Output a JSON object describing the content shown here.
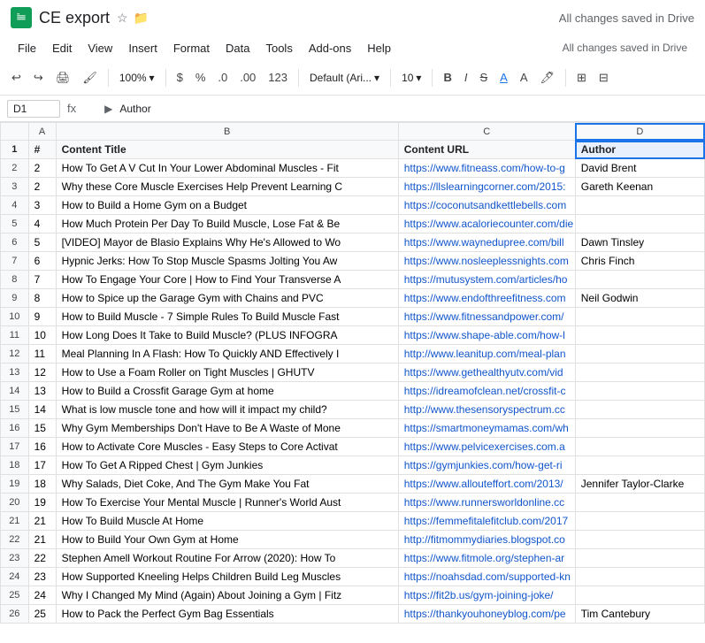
{
  "titleBar": {
    "appName": "CE export",
    "saveStatus": "All changes saved in Drive"
  },
  "menuBar": {
    "items": [
      "File",
      "Edit",
      "View",
      "Insert",
      "Format",
      "Data",
      "Tools",
      "Add-ons",
      "Help"
    ]
  },
  "toolbar": {
    "zoom": "100%",
    "currency": "$",
    "percent": "%",
    "decimal1": ".0",
    "decimal2": ".00",
    "number": "123",
    "font": "Default (Ari...",
    "fontSize": "10"
  },
  "formulaBar": {
    "cellRef": "D1",
    "value": "Author"
  },
  "sheet": {
    "columns": [
      "",
      "A",
      "B",
      "C",
      "D"
    ],
    "headers": [
      "#",
      "Content Title",
      "Content URL",
      "Author"
    ],
    "rows": [
      {
        "num": "1",
        "a": "2",
        "b": "How To Get A V Cut In Your Lower Abdominal Muscles - Fit",
        "c": "https://www.fitneass.com/how-to-g",
        "d": "David Brent"
      },
      {
        "num": "2",
        "a": "2",
        "b": "Why these Core Muscle Exercises Help Prevent Learning C",
        "c": "https://llslearningcorner.com/2015:",
        "d": "Gareth Keenan"
      },
      {
        "num": "3",
        "a": "3",
        "b": "How to Build a Home Gym on a Budget",
        "c": "https://coconutsandkettlebells.com",
        "d": ""
      },
      {
        "num": "4",
        "a": "4",
        "b": "How Much Protein Per Day To Build Muscle, Lose Fat & Be",
        "c": "https://www.acaloriecounter.com/die",
        "d": ""
      },
      {
        "num": "5",
        "a": "5",
        "b": "[VIDEO] Mayor de Blasio Explains Why He's Allowed to Wo",
        "c": "https://www.waynedupree.com/bill",
        "d": "Dawn Tinsley"
      },
      {
        "num": "6",
        "a": "6",
        "b": "Hypnic Jerks: How To Stop Muscle Spasms Jolting You Aw",
        "c": "https://www.nosleeplessnights.com",
        "d": "Chris Finch"
      },
      {
        "num": "7",
        "a": "7",
        "b": "How To Engage Your Core | How to Find Your Transverse A",
        "c": "https://mutusystem.com/articles/ho",
        "d": ""
      },
      {
        "num": "8",
        "a": "8",
        "b": "How to Spice up the Garage Gym with Chains and PVC",
        "c": "https://www.endofthreefitness.com",
        "d": "Neil Godwin"
      },
      {
        "num": "9",
        "a": "9",
        "b": "How to Build Muscle - 7 Simple Rules To Build Muscle Fast",
        "c": "https://www.fitnessandpower.com/",
        "d": ""
      },
      {
        "num": "10",
        "a": "10",
        "b": "How Long Does It Take to Build Muscle? (PLUS INFOGRA",
        "c": "https://www.shape-able.com/how-l",
        "d": ""
      },
      {
        "num": "11",
        "a": "11",
        "b": "Meal Planning In A Flash: How To Quickly AND Effectively I",
        "c": "http://www.leanitup.com/meal-plan",
        "d": ""
      },
      {
        "num": "12",
        "a": "12",
        "b": "How to Use a Foam Roller on Tight Muscles | GHUTV",
        "c": "https://www.gethealthyutv.com/vid",
        "d": ""
      },
      {
        "num": "13",
        "a": "13",
        "b": "How to Build a Crossfit Garage Gym at home",
        "c": "https://idreamofclean.net/crossfit-c",
        "d": ""
      },
      {
        "num": "14",
        "a": "14",
        "b": "What is low muscle tone and how will it impact my child?",
        "c": "http://www.thesensoryspectrum.cc",
        "d": ""
      },
      {
        "num": "15",
        "a": "15",
        "b": "Why Gym Memberships Don't Have to Be A Waste of Mone",
        "c": "https://smartmoneymamas.com/wh",
        "d": ""
      },
      {
        "num": "16",
        "a": "16",
        "b": "How to Activate Core Muscles - Easy Steps to Core Activat",
        "c": "https://www.pelvicexercises.com.a",
        "d": ""
      },
      {
        "num": "17",
        "a": "17",
        "b": "How To Get A Ripped Chest | Gym Junkies",
        "c": "https://gymjunkies.com/how-get-ri",
        "d": ""
      },
      {
        "num": "18",
        "a": "18",
        "b": "Why Salads, Diet Coke, And The Gym Make You Fat",
        "c": "https://www.allouteffort.com/2013/",
        "d": "Jennifer Taylor-Clarke"
      },
      {
        "num": "19",
        "a": "19",
        "b": "How To Exercise Your Mental Muscle | Runner's World Aust",
        "c": "https://www.runnersworldonline.cc",
        "d": ""
      },
      {
        "num": "20",
        "a": "21",
        "b": "How To Build Muscle At Home",
        "c": "https://femmefitalefitclub.com/2017",
        "d": ""
      },
      {
        "num": "21",
        "a": "21",
        "b": "How to Build Your Own Gym at Home",
        "c": "http://fitmommydiaries.blogspot.co",
        "d": ""
      },
      {
        "num": "22",
        "a": "22",
        "b": "Stephen Amell Workout Routine For Arrow (2020): How To",
        "c": "https://www.fitmole.org/stephen-ar",
        "d": ""
      },
      {
        "num": "23",
        "a": "23",
        "b": "How Supported Kneeling Helps Children Build Leg Muscles",
        "c": "https://noahsdad.com/supported-kn",
        "d": ""
      },
      {
        "num": "24",
        "a": "24",
        "b": "Why I Changed My Mind (Again) About Joining a Gym | Fitz",
        "c": "https://fit2b.us/gym-joining-joke/",
        "d": ""
      },
      {
        "num": "25",
        "a": "25",
        "b": "How to Pack the Perfect Gym Bag Essentials",
        "c": "https://thankyouhoneyblog.com/pe",
        "d": "Tim Cantebury"
      }
    ]
  }
}
